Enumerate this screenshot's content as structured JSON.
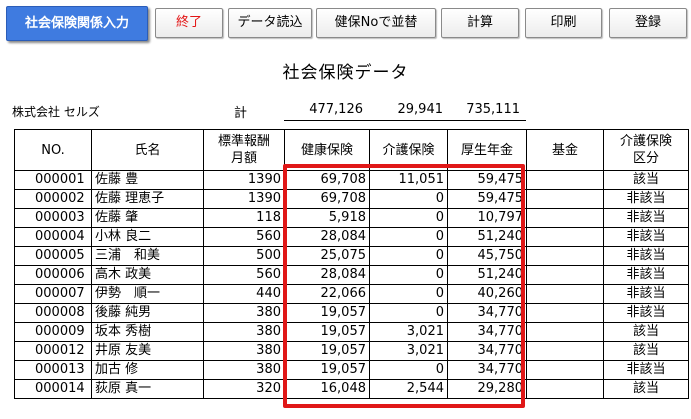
{
  "toolbar": {
    "title_button": "社会保険関係入力",
    "exit": "終了",
    "load": "データ読込",
    "sort": "健保Noで並替",
    "calc": "計算",
    "print": "印刷",
    "register": "登録"
  },
  "sheet": {
    "title": "社会保険データ",
    "company": "株式会社 セルズ",
    "total_label": "計",
    "total_health": "477,126",
    "total_care": "29,941",
    "total_pension": "735,111"
  },
  "columns": {
    "no": "NO.",
    "name": "氏名",
    "std_line1": "標準報酬",
    "std_line2": "月額",
    "health": "健康保険",
    "care": "介護保険",
    "pension": "厚生年金",
    "fund": "基金",
    "care_flag_line1": "介護保険",
    "care_flag_line2": "区分"
  },
  "rows": [
    {
      "no": "000001",
      "name": "佐藤 豊",
      "std": "1390",
      "health": "69,708",
      "care": "11,051",
      "pension": "59,475",
      "fund": "",
      "flag": "該当"
    },
    {
      "no": "000002",
      "name": "佐藤 理恵子",
      "std": "1390",
      "health": "69,708",
      "care": "0",
      "pension": "59,475",
      "fund": "",
      "flag": "非該当"
    },
    {
      "no": "000003",
      "name": "佐藤 肇",
      "std": "118",
      "health": "5,918",
      "care": "0",
      "pension": "10,797",
      "fund": "",
      "flag": "非該当"
    },
    {
      "no": "000004",
      "name": "小林 良二",
      "std": "560",
      "health": "28,084",
      "care": "0",
      "pension": "51,240",
      "fund": "",
      "flag": "非該当"
    },
    {
      "no": "000005",
      "name": "三浦　和美",
      "std": "500",
      "health": "25,075",
      "care": "0",
      "pension": "45,750",
      "fund": "",
      "flag": "非該当"
    },
    {
      "no": "000006",
      "name": "高木 政美",
      "std": "560",
      "health": "28,084",
      "care": "0",
      "pension": "51,240",
      "fund": "",
      "flag": "非該当"
    },
    {
      "no": "000007",
      "name": "伊勢　順一",
      "std": "440",
      "health": "22,066",
      "care": "0",
      "pension": "40,260",
      "fund": "",
      "flag": "非該当"
    },
    {
      "no": "000008",
      "name": "後藤 純男",
      "std": "380",
      "health": "19,057",
      "care": "0",
      "pension": "34,770",
      "fund": "",
      "flag": "非該当"
    },
    {
      "no": "000009",
      "name": "坂本 秀樹",
      "std": "380",
      "health": "19,057",
      "care": "3,021",
      "pension": "34,770",
      "fund": "",
      "flag": "該当"
    },
    {
      "no": "000012",
      "name": "井原 友美",
      "std": "380",
      "health": "19,057",
      "care": "3,021",
      "pension": "34,770",
      "fund": "",
      "flag": "該当"
    },
    {
      "no": "000013",
      "name": "加古 修",
      "std": "380",
      "health": "19,057",
      "care": "0",
      "pension": "34,770",
      "fund": "",
      "flag": "非該当"
    },
    {
      "no": "000014",
      "name": "荻原 真一",
      "std": "320",
      "health": "16,048",
      "care": "2,544",
      "pension": "29,280",
      "fund": "",
      "flag": "該当"
    }
  ]
}
